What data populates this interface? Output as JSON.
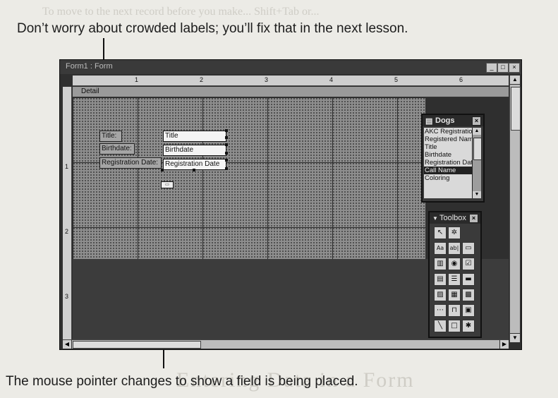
{
  "captions": {
    "top": "Don’t worry about crowded labels; you’ll fix that in the next lesson.",
    "bottom": "The mouse pointer changes to show a field is being placed."
  },
  "window": {
    "title": "Form1 : Form",
    "minimize_glyph": "_",
    "restore_glyph": "□",
    "close_glyph": "×",
    "section": "Detail"
  },
  "ruler": {
    "h_marks": [
      "1",
      "2",
      "3",
      "4",
      "5",
      "6"
    ],
    "v_marks": [
      "1",
      "2",
      "3"
    ]
  },
  "form_controls": [
    {
      "label": "Title:",
      "field": "Title"
    },
    {
      "label": "Birthdate:",
      "field": "Birthdate"
    },
    {
      "label": "Registration Date:",
      "field": "Registration Date"
    }
  ],
  "field_list": {
    "title": "Dogs",
    "items": [
      "AKC Registration",
      "Registered Name",
      "Title",
      "Birthdate",
      "Registration Date",
      "Call Name",
      "Coloring"
    ],
    "selected": "Call Name"
  },
  "toolbox": {
    "title": "Toolbox",
    "tools": [
      "pointer-tool-icon",
      "wizard-tool-icon",
      "label-tool-icon",
      "textbox-tool-icon",
      "optiongroup-tool-icon",
      "togglebutton-tool-icon",
      "optionbutton-tool-icon",
      "checkbox-tool-icon",
      "combobox-tool-icon",
      "listbox-tool-icon",
      "commandbutton-tool-icon",
      "image-tool-icon",
      "unbound-frame-tool-icon",
      "bound-frame-tool-icon",
      "pagebreak-tool-icon",
      "tabcontrol-tool-icon",
      "subform-tool-icon",
      "line-tool-icon",
      "rectangle-tool-icon",
      "moretools-tool-icon"
    ]
  },
  "background_text": {
    "top_ghost": "To move to the next record before you make... Shift+Tab or...",
    "bottom_ghost": "Entering Data in a Form"
  }
}
